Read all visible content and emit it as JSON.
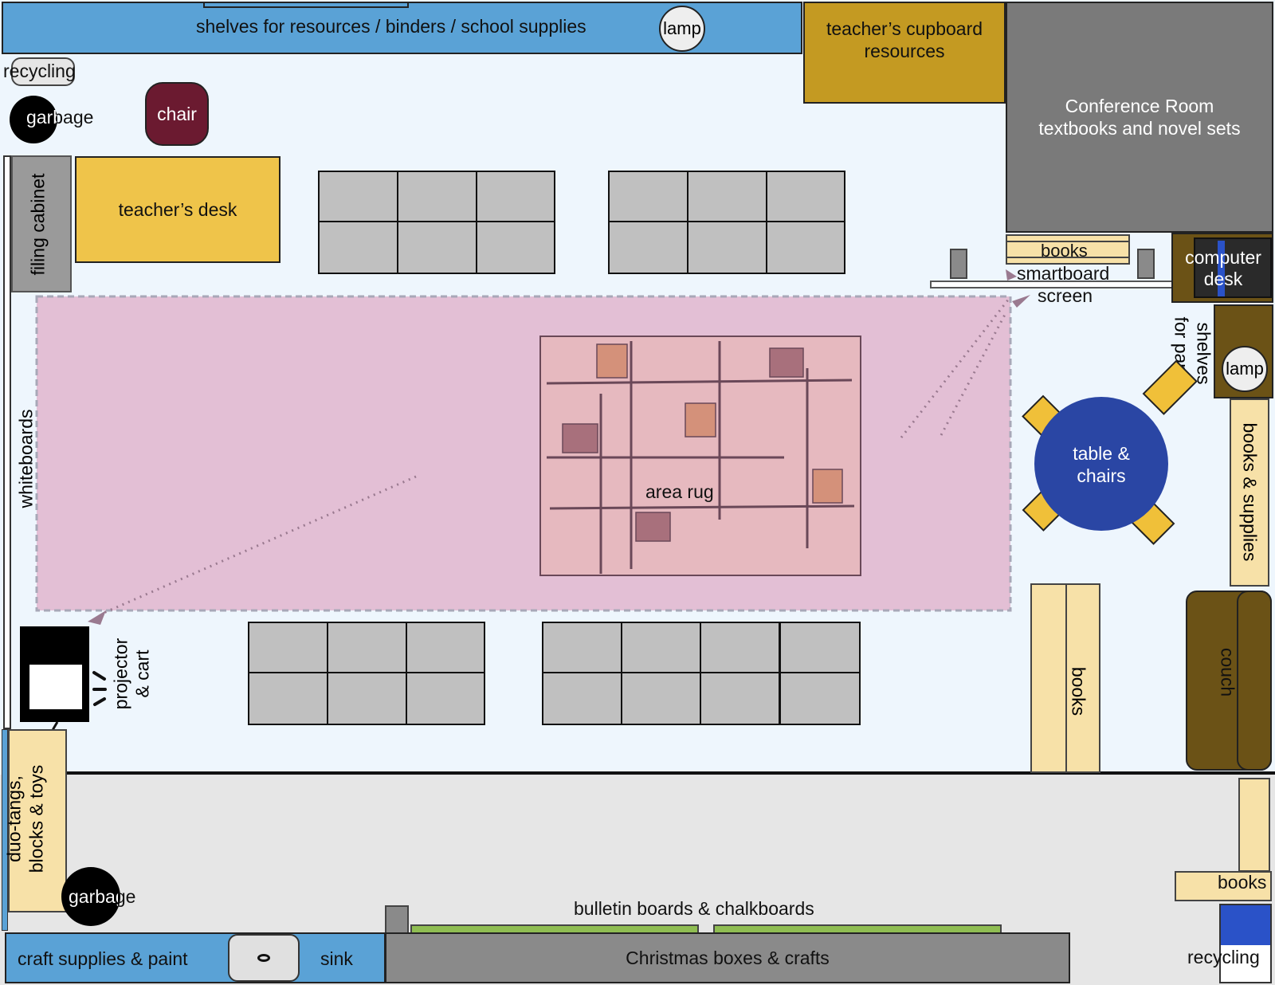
{
  "labels": {
    "top_shelves": "shelves for resources / binders / school supplies",
    "lamp_top": "lamp",
    "teacher_cupboard_line1": "teacher’s cupboard",
    "teacher_cupboard_line2": "resources",
    "conference_line1": "Conference Room",
    "conference_line2": "textbooks and novel sets",
    "recycling_top": "recycling",
    "garbage_top": "garbage",
    "chair": "chair",
    "filing_cabinet": "filing cabinet",
    "teachers_desk": "teacher’s desk",
    "books_small": "books",
    "smartboard": "smartboard",
    "screen": "screen",
    "computer_desk_line1": "computer",
    "computer_desk_line2": "desk",
    "shelves_paper_line1": "shelves",
    "shelves_paper_line2": "for paper",
    "lamp_right": "lamp",
    "whiteboards": "whiteboards",
    "area_rug": "area rug",
    "table_chairs_line1": "table &",
    "table_chairs_line2": "chairs",
    "books_supplies": "books & supplies",
    "projector_line1": "projector",
    "projector_line2": "& cart",
    "books_tall": "books",
    "couch": "couch",
    "duo_tangs_line1": "duo-tangs,",
    "duo_tangs_line2": "blocks & toys",
    "garbage_bottom": "garbage",
    "bulletin_boards": "bulletin boards & chalkboards",
    "books_bottom_right": "books",
    "recycling_bottom": "recycling",
    "craft_supplies": "craft supplies & paint",
    "sink": "sink",
    "christmas_boxes": "Christmas boxes & crafts"
  },
  "colors": {
    "floor": "#eef6fd",
    "hallway": "#e6e6e6",
    "blue_shelf": "#5aa2d6",
    "gold_cupboard": "#c49a22",
    "conference": "#7a7a7a",
    "teacher_desk": "#efc44a",
    "chair": "#6b1a30",
    "student_desk": "#c0c0c0",
    "carpet_zone": "#e3bfd5",
    "rug": "#e6b9bf",
    "rug_line": "#6a4858",
    "tan": "#f7e1a8",
    "table": "#2a46a4",
    "table_chairs": "#f0c039",
    "brown": "#6b5216",
    "green_board": "#8fbd52",
    "recycling_blue": "#2a52c8"
  }
}
